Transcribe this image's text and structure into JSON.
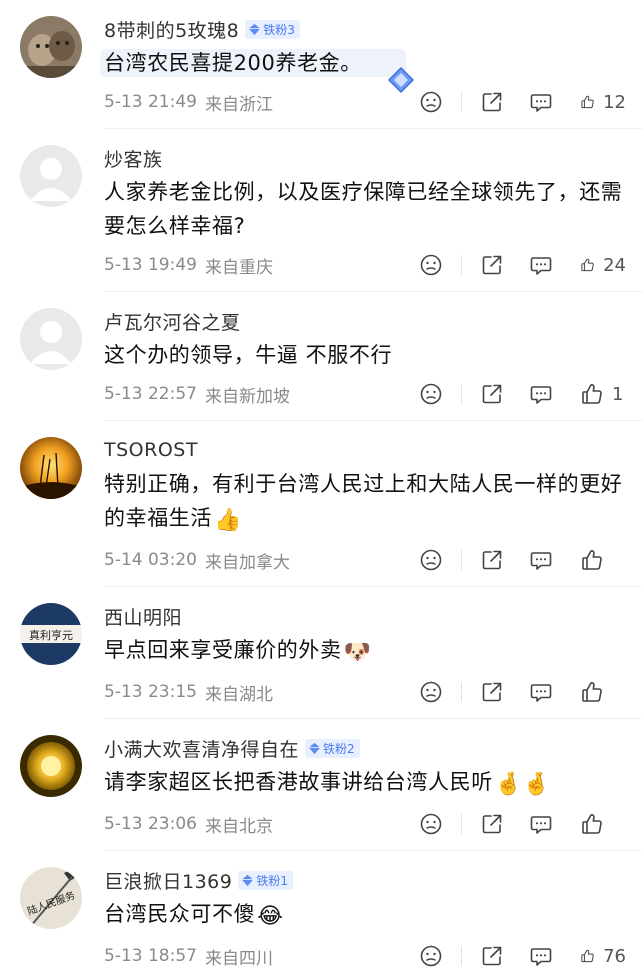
{
  "comments": [
    {
      "name": "8带刺的5玫瑰8",
      "badge": "铁粉3",
      "text": "台湾农民喜提200养老金。",
      "time": "5-13 21:49",
      "location": "来自浙江",
      "likes": "12"
    },
    {
      "name": "炒客族",
      "badge": "",
      "text": "人家养老金比例，以及医疗保障已经全球领先了，还需要怎么样幸福?",
      "time": "5-13 19:49",
      "location": "来自重庆",
      "likes": "24"
    },
    {
      "name": "卢瓦尔河谷之夏",
      "badge": "",
      "text": "这个办的领导，牛逼 不服不行",
      "time": "5-13 22:57",
      "location": "来自新加坡",
      "likes": "1"
    },
    {
      "name": "TSOROST",
      "badge": "",
      "text": "特别正确，有利于台湾人民过上和大陆人民一样的更好的幸福生活",
      "emoji": "👍",
      "time": "5-14 03:20",
      "location": "来自加拿大",
      "likes": ""
    },
    {
      "name": "西山明阳",
      "badge": "",
      "text": "早点回来享受廉价的外卖",
      "emoji": "🐶",
      "time": "5-13 23:15",
      "location": "来自湖北",
      "likes": ""
    },
    {
      "name": "小满大欢喜清净得自在",
      "badge": "铁粉2",
      "text": "请李家超区长把香港故事讲给台湾人民听",
      "emoji": "🤞🤞",
      "time": "5-13 23:06",
      "location": "来自北京",
      "likes": ""
    },
    {
      "name": "巨浪掀日1369",
      "badge": "铁粉1",
      "text": "台湾民众可不傻",
      "emoji": "😂",
      "time": "5-13 18:57",
      "location": "来自四川",
      "likes": "76"
    }
  ],
  "avatars": {
    "avatar_4_text": "真利亨元",
    "avatar_6_text": "陆人民服务"
  },
  "colors": {
    "badge_text": "#4a7cf0",
    "badge_bg": "#e8efff",
    "meta": "#8a8a8a"
  }
}
